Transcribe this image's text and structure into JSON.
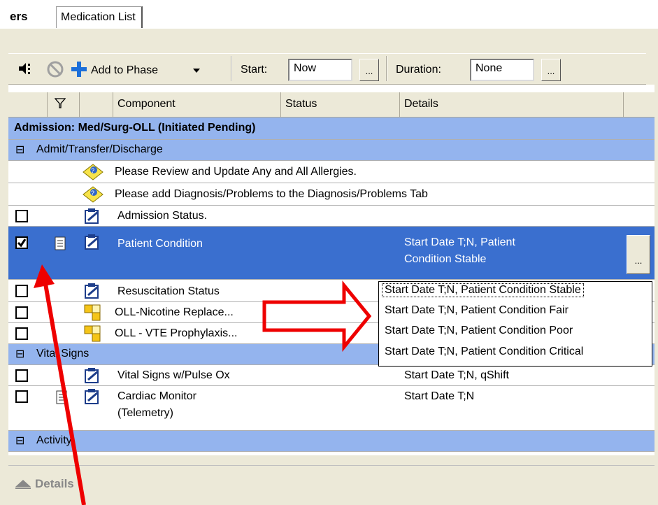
{
  "tabs": {
    "truncated_tab": "ers",
    "medication_list": "Medication List"
  },
  "toolbar": {
    "add_to_phase": "Add to Phase",
    "start_label": "Start:",
    "start_value": "Now",
    "duration_label": "Duration:",
    "duration_value": "None",
    "ellipsis": "..."
  },
  "columns": {
    "component": "Component",
    "status": "Status",
    "details": "Details"
  },
  "plan_header": "Admission: Med/Surg-OLL (Initiated Pending)",
  "sections": {
    "admit": "Admit/Transfer/Discharge",
    "vitals": "Vital Signs",
    "activity": "Activity",
    "collapse_symbol": "⊟"
  },
  "rows": {
    "allergies": "Please Review and Update Any and All Allergies.",
    "diagnosis": "Please add Diagnosis/Problems to the Diagnosis/Problems Tab",
    "admission_status": "Admission Status.",
    "patient_condition": "Patient Condition",
    "patient_condition_details_1": "Start Date T;N, Patient",
    "patient_condition_details_2": "Condition Stable",
    "resuscitation": "Resuscitation Status",
    "nicotine": "OLL-Nicotine Replace",
    "vte": "OLL - VTE Prophylaxis",
    "vitals_pulse": "Vital Signs w/Pulse Ox",
    "vitals_pulse_details": "Start Date T;N, qShift",
    "cardiac_1": "Cardiac Monitor",
    "cardiac_2": "(Telemetry)",
    "cardiac_details": "Start Date T;N"
  },
  "dropdown_options": [
    "Start Date T;N, Patient Condition Stable",
    "Start Date T;N, Patient Condition Fair",
    "Start Date T;N, Patient Condition Poor",
    "Start Date T;N, Patient Condition Critical"
  ],
  "details_bar": "Details",
  "colors": {
    "section_blue": "#94b4ee",
    "selected_row": "#3a6fcf",
    "annotation_red": "#ee0000"
  }
}
